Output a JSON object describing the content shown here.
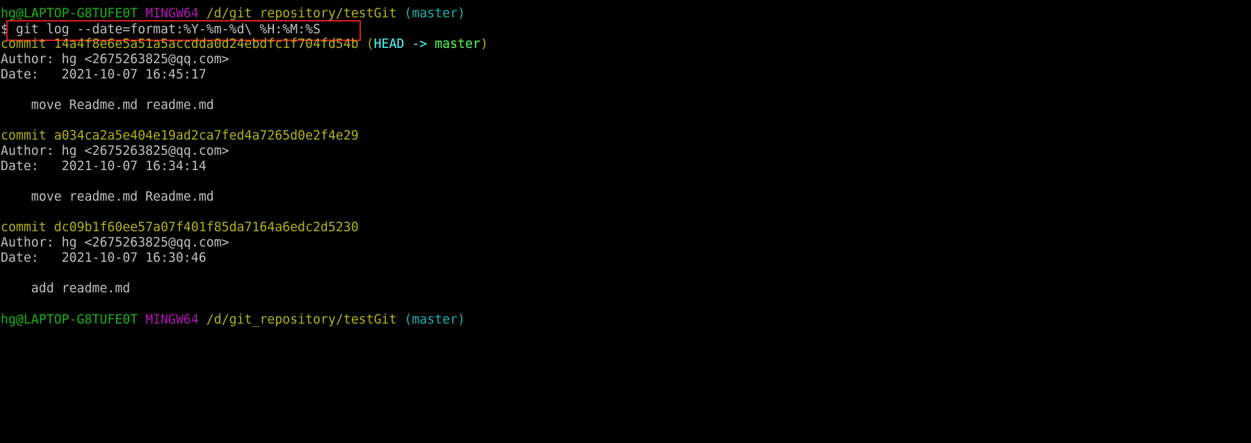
{
  "prompt_top": {
    "user_host": "hg@LAPTOP-G8TUFE0T",
    "shell": "MINGW64",
    "path": "/d/git_repository/testGit",
    "branch": "(master)"
  },
  "command": {
    "prompt_symbol": "$",
    "text": "git log --date=format:%Y-%m-%d\\ %H:%M:%S"
  },
  "commits": [
    {
      "commit_label": "commit 14a4f8e6e5a51a5accdda0d24ebdfc1f704fd54b",
      "refs_open": "(",
      "head": "HEAD -> ",
      "ref_branch": "master",
      "refs_close": ")",
      "author": "Author: hg <2675263825@qq.com>",
      "date": "Date:   2021-10-07 16:45:17",
      "message": "    move Readme.md readme.md"
    },
    {
      "commit_label": "commit a034ca2a5e404e19ad2ca7fed4a7265d0e2f4e29",
      "author": "Author: hg <2675263825@qq.com>",
      "date": "Date:   2021-10-07 16:34:14",
      "message": "    move readme.md Readme.md"
    },
    {
      "commit_label": "commit dc09b1f60ee57a07f401f85da7164a6edc2d5230",
      "author": "Author: hg <2675263825@qq.com>",
      "date": "Date:   2021-10-07 16:30:46",
      "message": "    add readme.md"
    }
  ],
  "prompt_bottom": {
    "user_host": "hg@LAPTOP-G8TUFE0T",
    "shell": "MINGW64",
    "path": "/d/git_repository/testGit",
    "branch": "(master)"
  },
  "colors": {
    "background": "#000000",
    "user_host": "#18b218",
    "shell": "#b218b2",
    "path": "#b2b218",
    "branch": "#18b2b2",
    "commit_hash": "#b2b218",
    "head_ref": "#54fefe",
    "branch_ref": "#54fe54",
    "text": "#c0c0c0",
    "highlight_box": "#e02020"
  }
}
